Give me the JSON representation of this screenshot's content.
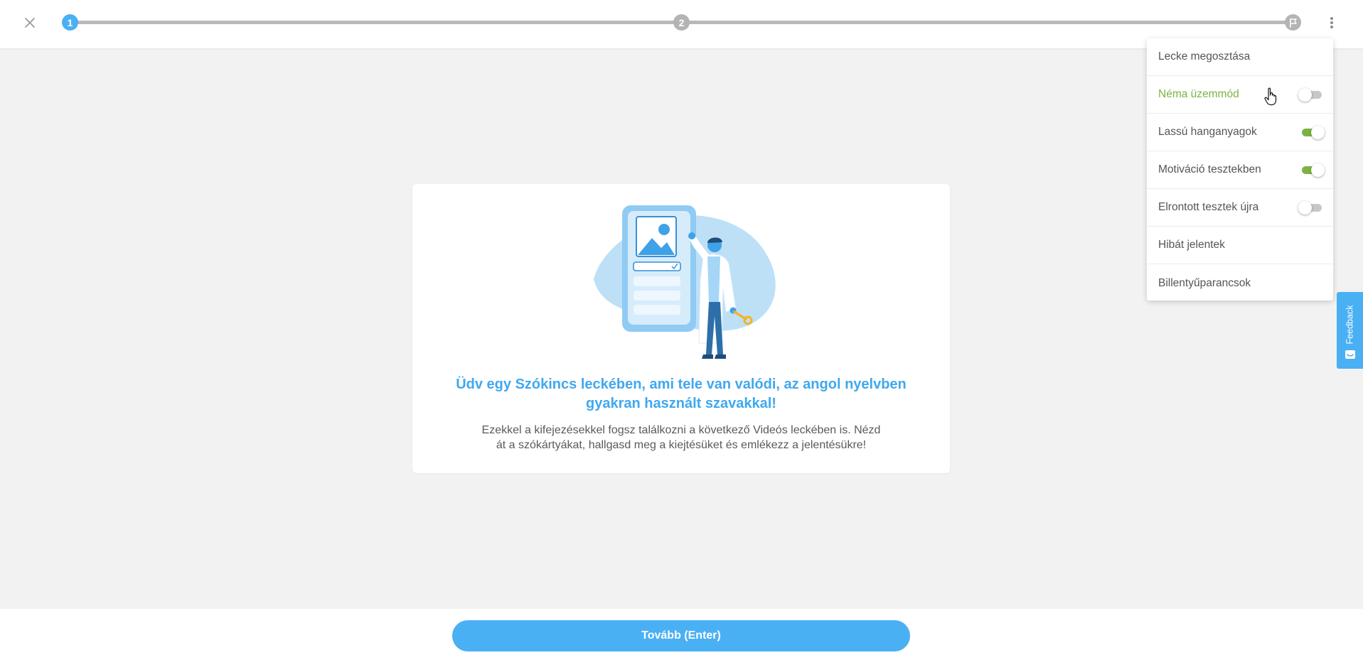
{
  "progress": {
    "steps": [
      {
        "label": "1",
        "state": "active"
      },
      {
        "label": "2",
        "state": "upcoming"
      }
    ],
    "finish_icon": "flag-icon",
    "fraction_complete": 0
  },
  "colors": {
    "accent": "#4ab0f4",
    "toggle_on": "#7cb342",
    "hover_text": "#7cb342",
    "title_blue": "#3fa8ef"
  },
  "menu": {
    "items": [
      {
        "label": "Lecke megosztása"
      },
      {
        "label": "Néma üzemmód",
        "toggle": "off"
      },
      {
        "label": "Lassú hanganyagok",
        "toggle": "on"
      },
      {
        "label": "Motiváció tesztekben",
        "toggle": "on"
      },
      {
        "label": "Elrontott tesztek újra",
        "toggle": "off"
      },
      {
        "label": "Hibát jelentek"
      },
      {
        "label": "Billentyűparancsok"
      }
    ]
  },
  "card": {
    "title": "Üdv egy Szókincs leckében, ami tele van valódi, az angol nyelvben gyakran használt szavakkal!",
    "text": "Ezekkel a kifejezésekkel fogsz találkozni a következő Videós leckében is. Nézd át a szókártyákat, hallgasd meg a kiejtésüket és emlékezz a jelentésükre!"
  },
  "feedback": {
    "label": "Feedback"
  },
  "footer": {
    "next_label": "Tovább (Enter)"
  }
}
